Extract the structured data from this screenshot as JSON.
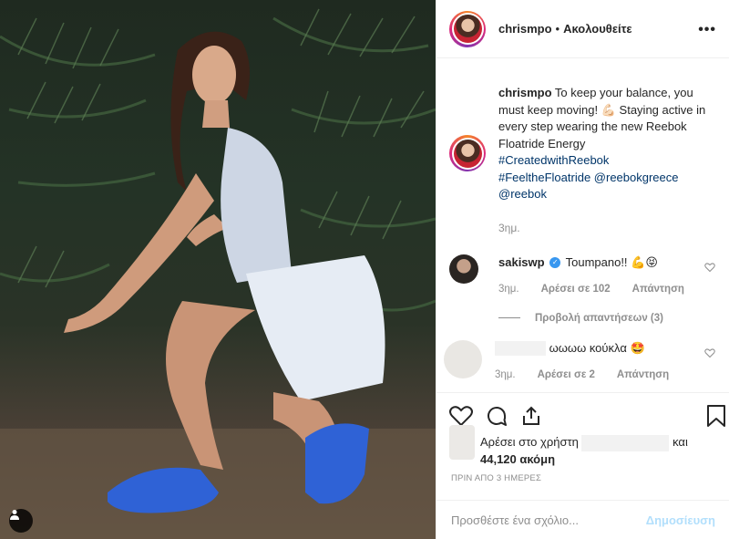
{
  "post_author": "chrismpo",
  "header": {
    "separator": "•",
    "follow_label": "Ακολουθείτε",
    "more_label": "•••"
  },
  "caption": {
    "username": "chrismpo",
    "text_1": "To keep your balance, you must keep moving!",
    "emoji": "💪🏻",
    "text_2": "Staying active in every step wearing the new Reebok Floatride Energy",
    "tag_1": "#CreatedwithReebok",
    "tag_2": "#FeeltheFloatride",
    "mention_1": "@reebokgreece",
    "mention_2": "@reebok",
    "time": "3ημ."
  },
  "comments": [
    {
      "username": "sakiswp",
      "verified_mark": "✓",
      "text": "Toumpano!!",
      "emoji": "💪😝",
      "time": "3ημ.",
      "likes": "Αρέσει σε 102",
      "reply": "Απάντηση",
      "view_replies": "Προβολή απαντήσεων (3)"
    },
    {
      "text": "ωωωω κούκλα",
      "emoji": "🤩",
      "time": "3ημ.",
      "likes": "Αρέσει σε 2",
      "reply": "Απάντηση"
    }
  ],
  "likes": {
    "prefix": "Αρέσει στο χρήστη",
    "and_label": "και",
    "count": "44,120 ακόμη"
  },
  "timestamp": "ΠΡΙΝ ΑΠΟ 3 ΗΜΕΡΕΣ",
  "add_comment": {
    "placeholder": "Προσθέστε ένα σχόλιο...",
    "post_label": "Δημοσίευση"
  },
  "colors": {
    "link": "#003569",
    "secondary": "#8e8e8e",
    "post_disabled": "#b2dffc",
    "verified": "#3897f0",
    "story_ring_start": "#f58529",
    "story_ring_end": "#dd2a7b"
  },
  "icons": [
    "heart-icon",
    "comment-icon",
    "share-icon",
    "bookmark-icon",
    "user-tag-icon",
    "more-icon"
  ]
}
